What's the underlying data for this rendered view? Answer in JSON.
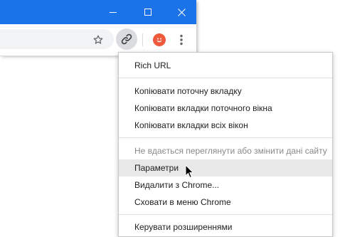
{
  "window_controls": {
    "minimize": "minimize-icon",
    "maximize": "maximize-icon",
    "close": "close-icon"
  },
  "toolbar": {
    "bookmark_icon": "star-icon",
    "extension_icon": "link-icon",
    "profile_icon": "smiley-avatar-icon",
    "menu_icon": "kebab-menu-icon"
  },
  "colors": {
    "titlebar": "#1a73e8",
    "menu_hover": "#e8e8e8",
    "avatar": "#ef5a3c"
  },
  "menu": {
    "title": "Rich URL",
    "copy_current_tab": "Копіювати поточну вкладку",
    "copy_window_tabs": "Копіювати вкладки поточного вікна",
    "copy_all_tabs": "Копіювати вкладки всіх вікон",
    "site_access_disabled": "Не вдається переглянути або змінити дані сайту",
    "options": "Параметри",
    "remove": "Видалити з Chrome...",
    "hide": "Сховати в меню Chrome",
    "manage": "Керувати розширеннями"
  }
}
